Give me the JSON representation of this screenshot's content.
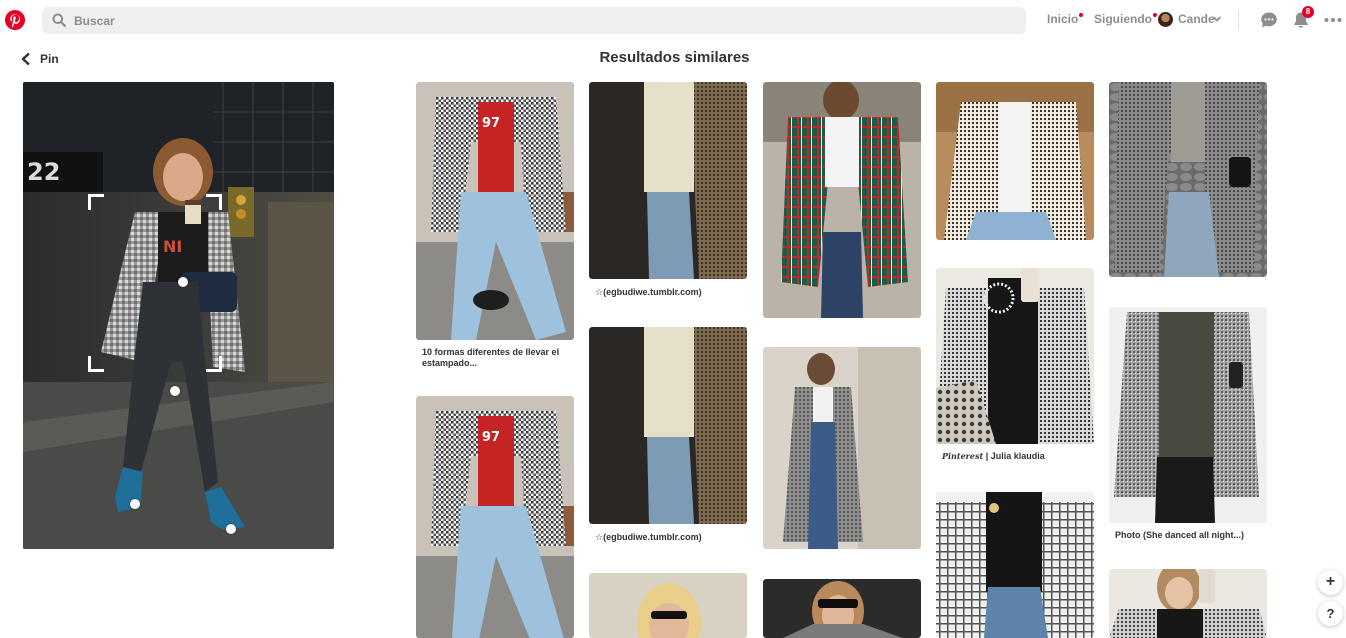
{
  "header": {
    "logo_icon": "pinterest-logo",
    "search_placeholder": "Buscar",
    "nav": {
      "home": "Inicio",
      "following": "Siguiendo",
      "user": "Cande"
    },
    "notifications_count": "8",
    "icons": [
      "search-icon",
      "chevron-down-icon",
      "chat-icon",
      "bell-icon",
      "more-icon"
    ],
    "accent_color": "#e60023"
  },
  "back_label": "Pin",
  "results_title": "Resultados similares",
  "pins": [
    {
      "caption": "10 formas diferentes de llevar el estampado..."
    },
    {
      "caption": "☆(egbudiwe.tumblr.com)"
    },
    {
      "caption": ""
    },
    {
      "caption": ""
    },
    {
      "caption": ""
    },
    {
      "caption": ""
    },
    {
      "caption": "☆(egbudiwe.tumblr.com)"
    },
    {
      "caption": ""
    },
    {
      "caption_script": "Pinterest",
      "caption": "| Julia klaudia"
    },
    {
      "caption": "Photo (She danced all night...)"
    }
  ],
  "floating": {
    "add": "+",
    "help": "?"
  }
}
